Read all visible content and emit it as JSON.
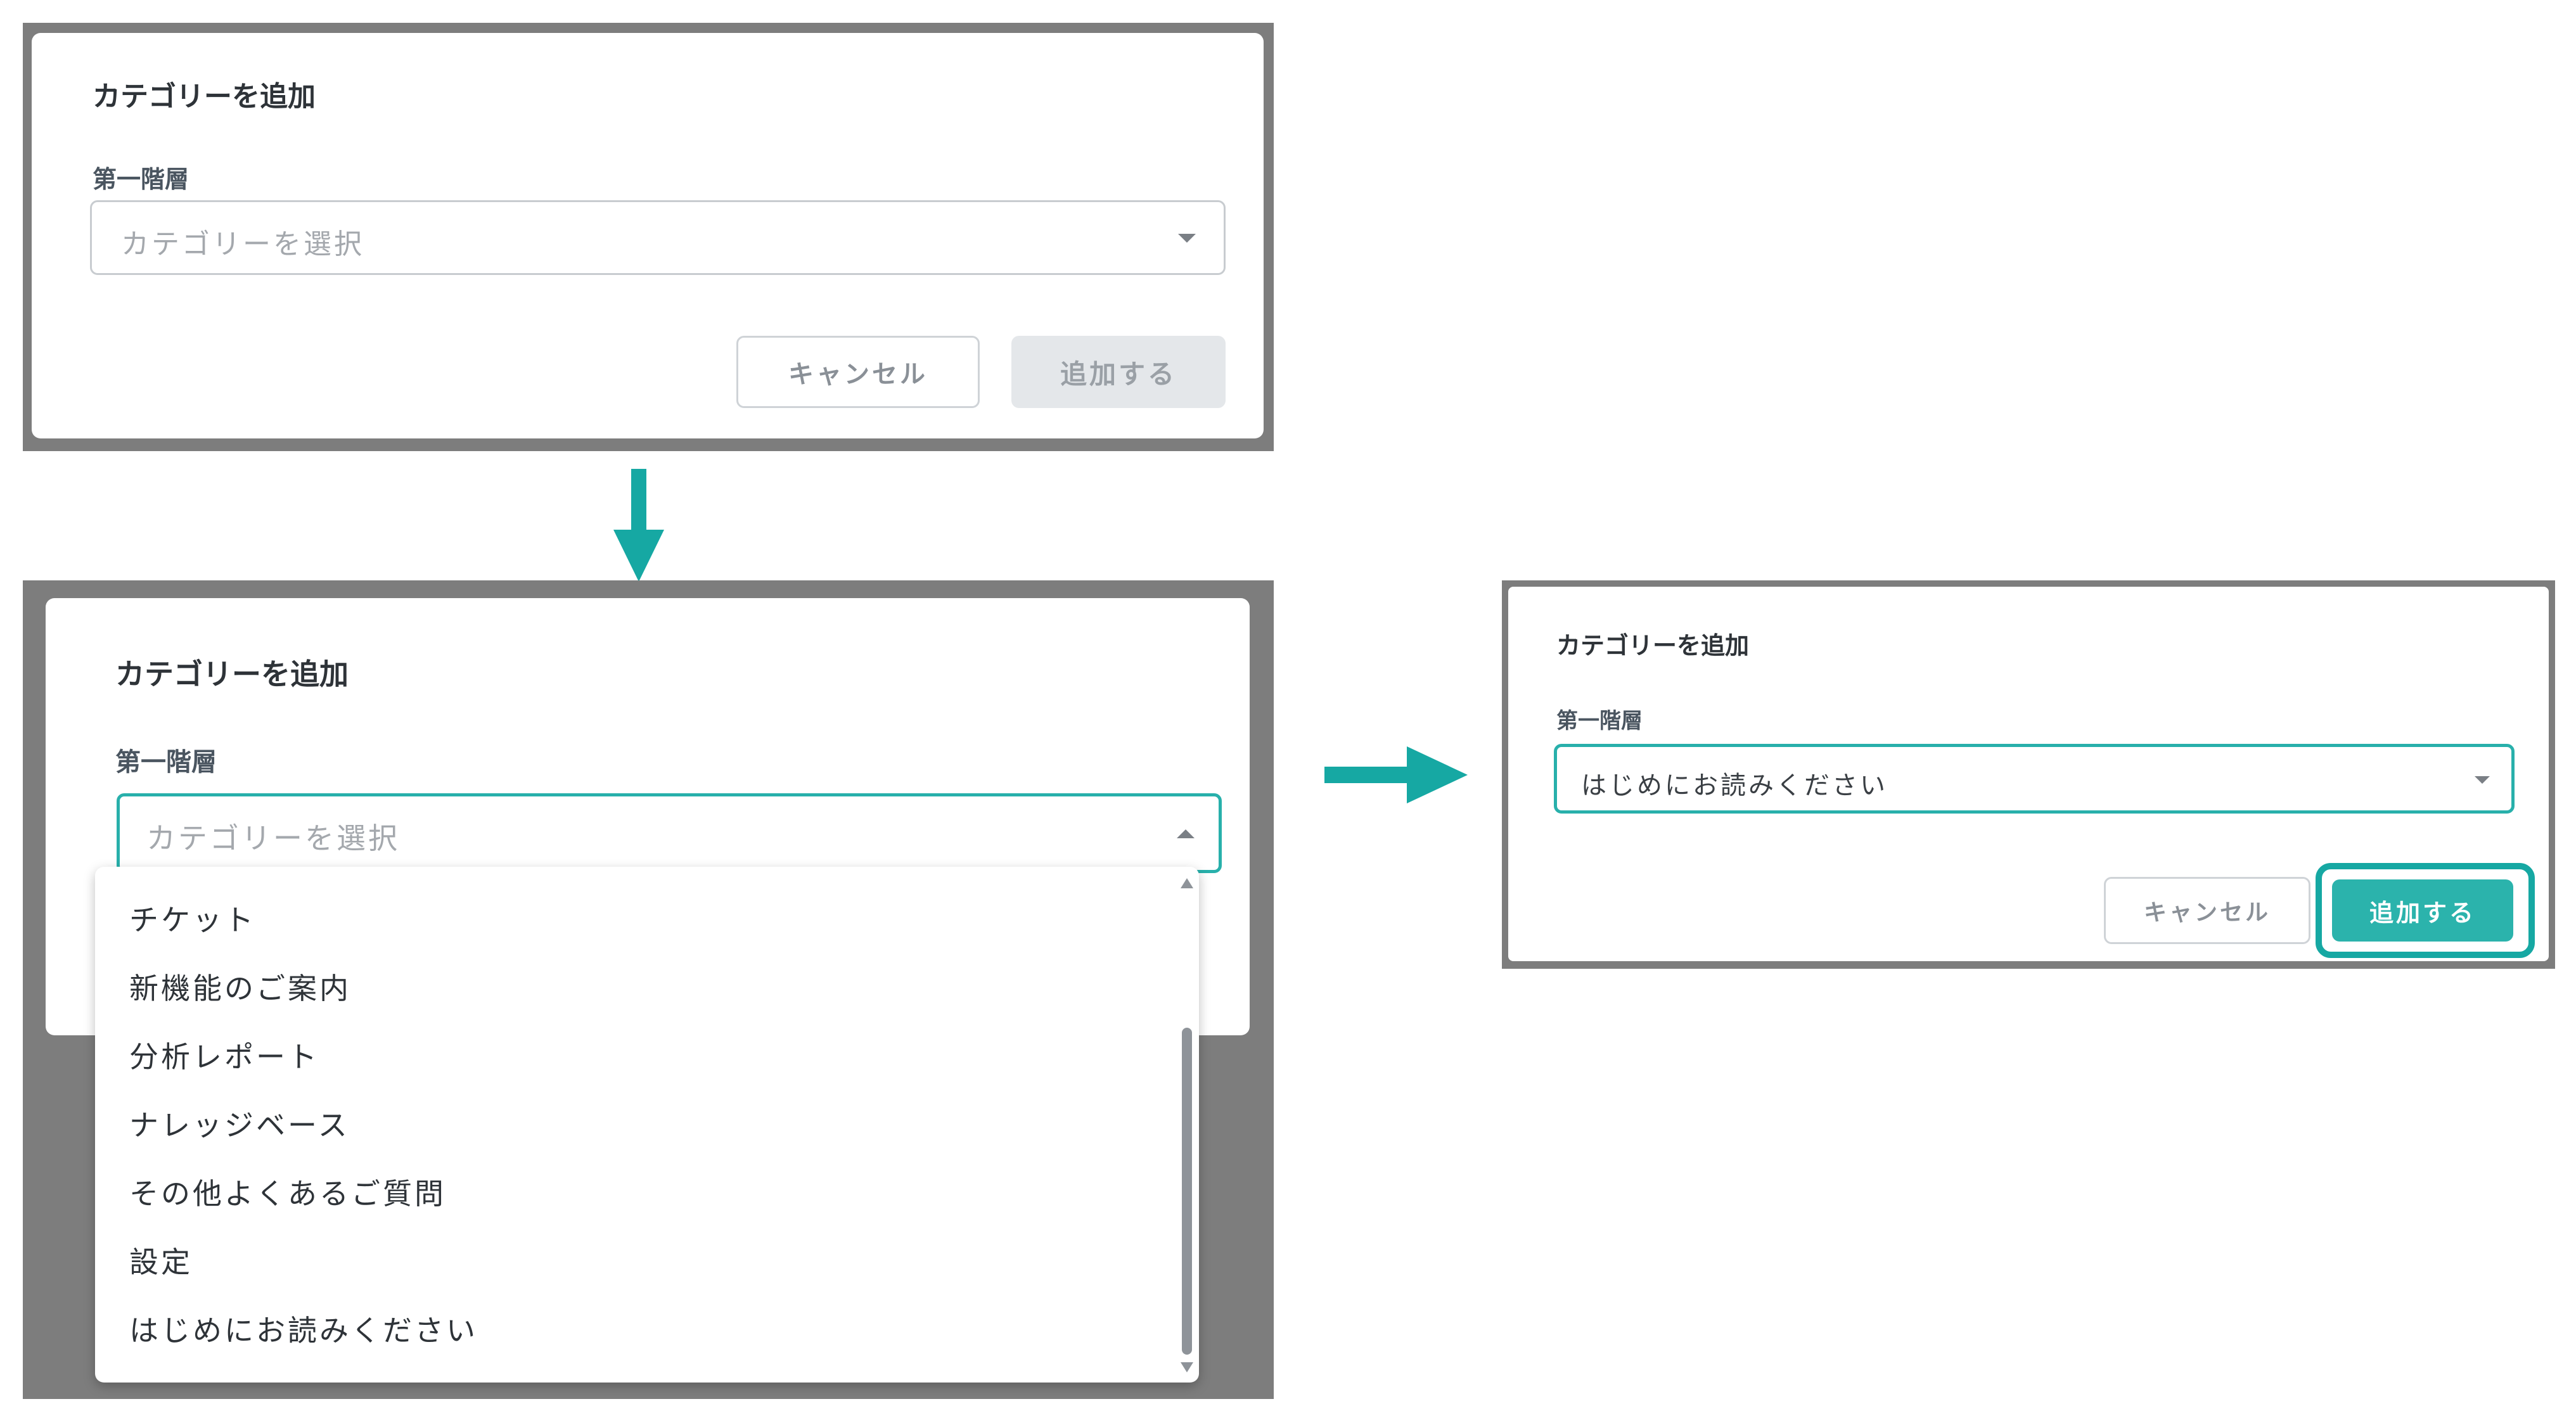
{
  "dialog": {
    "title": "カテゴリーを追加",
    "field_label": "第一階層",
    "placeholder": "カテゴリーを選択",
    "cancel_label": "キャンセル",
    "add_label": "追加する"
  },
  "dropdown": {
    "options": [
      "チケット",
      "新機能のご案内",
      "分析レポート",
      "ナレッジベース",
      "その他よくあるご質問",
      "設定",
      "はじめにお読みください"
    ]
  },
  "panel3": {
    "selected_value": "はじめにお読みください"
  },
  "colors": {
    "accent": "#2bb3ac",
    "arrow": "#16a8a3",
    "overlay": "#7d7d7d"
  }
}
